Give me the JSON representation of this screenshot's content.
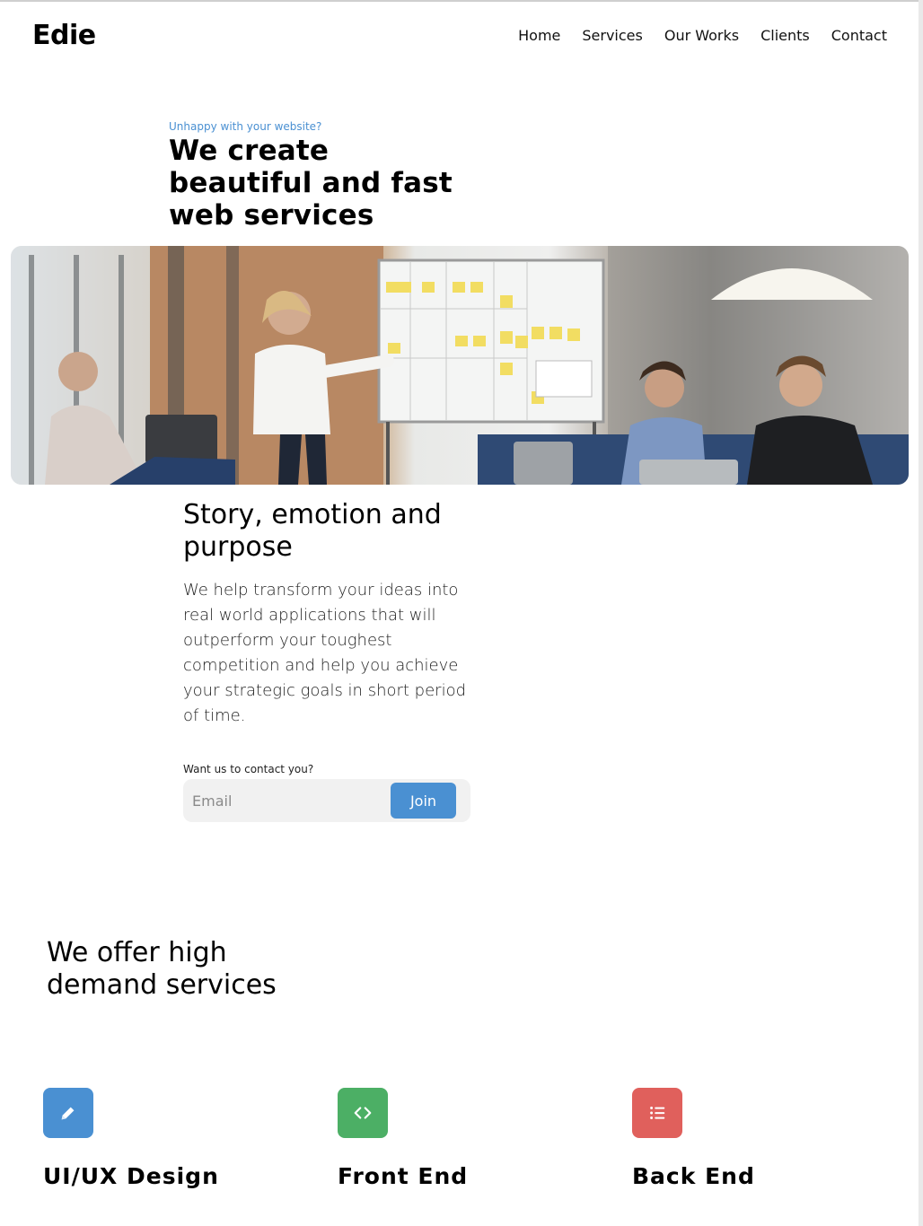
{
  "brand": {
    "logo": "Edie"
  },
  "nav": {
    "items": [
      "Home",
      "Services",
      "Our Works",
      "Clients",
      "Contact"
    ]
  },
  "hero": {
    "eyebrow": "Unhappy with your website?",
    "title": "We create beautiful and fast web services"
  },
  "story": {
    "title": "Story, emotion and purpose",
    "body": "We help transform your ideas into real world applications that will outperform your toughest competition and help you achieve your strategic goals in short period of time."
  },
  "contact": {
    "label": "Want us to contact you?",
    "email_placeholder": "Email",
    "join_label": "Join"
  },
  "offer": {
    "title": "We offer high demand services"
  },
  "services": [
    {
      "title": "UI/UX Design",
      "icon": "pencil-icon",
      "color": "#4a90d2"
    },
    {
      "title": "Front End",
      "icon": "code-icon",
      "color": "#4caf65"
    },
    {
      "title": "Back End",
      "icon": "list-icon",
      "color": "#e0605c"
    }
  ],
  "colors": {
    "accent": "#4a90d2",
    "green": "#4caf65",
    "red": "#e0605c"
  }
}
